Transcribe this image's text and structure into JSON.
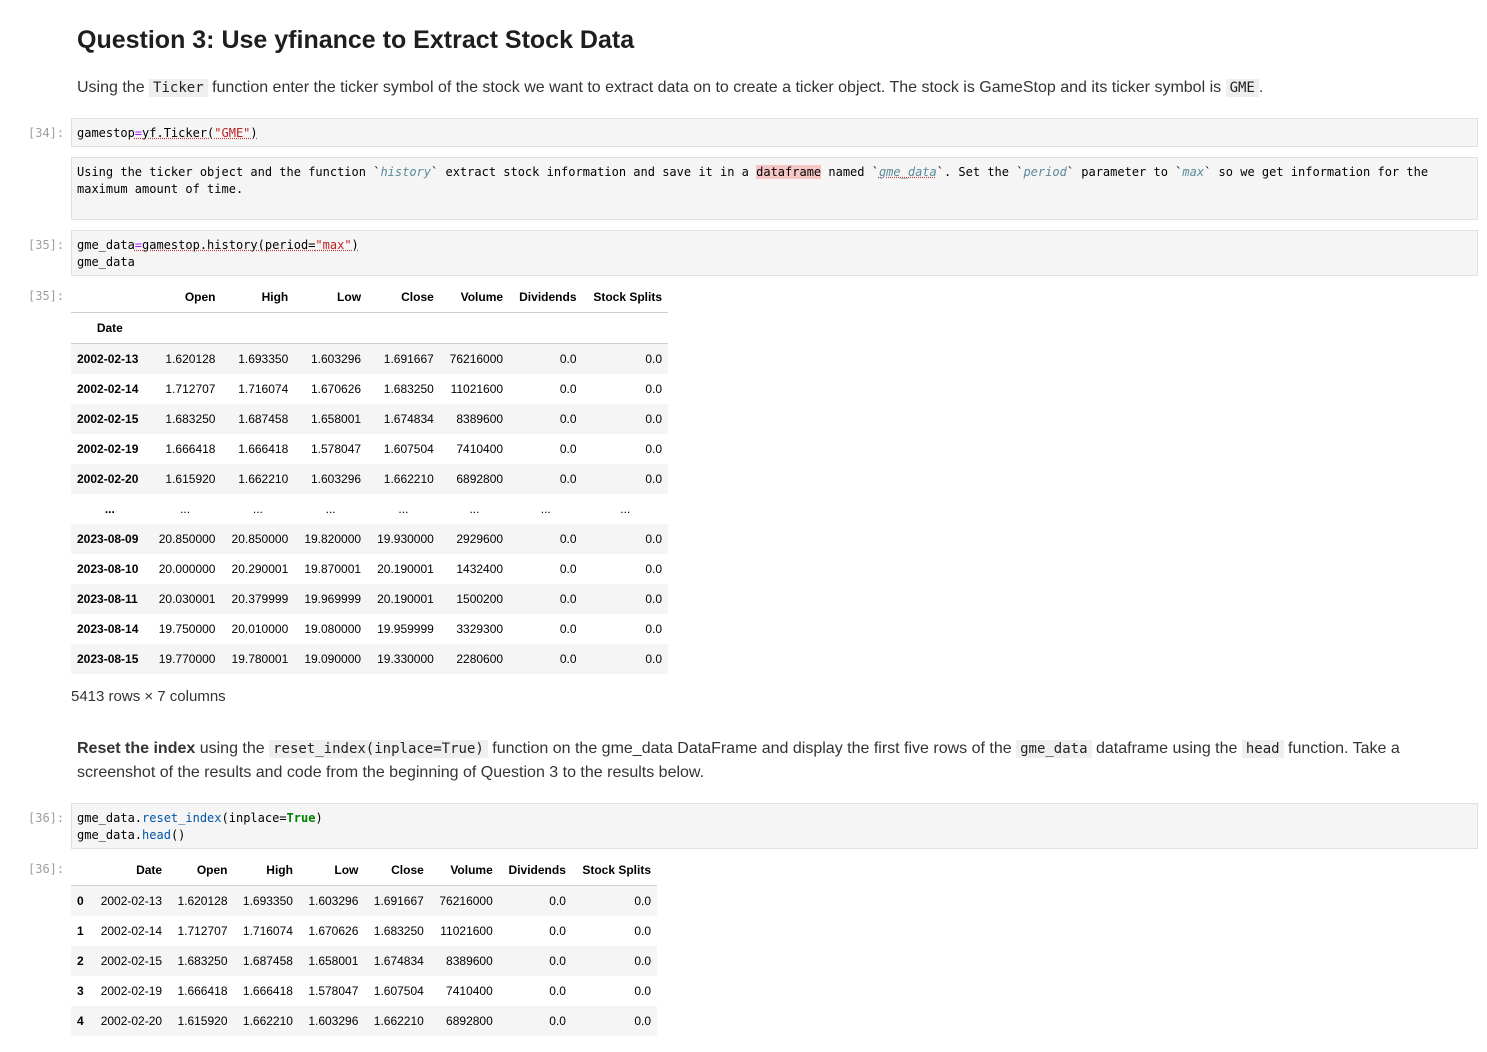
{
  "heading": "Question 3: Use yfinance to Extract Stock Data",
  "intro": {
    "p1": "Using the ",
    "code1": "Ticker",
    "p2": " function enter the ticker symbol of the stock we want to extract data on to create a ticker object. The stock is GameStop and its ticker symbol is ",
    "code2": "GME",
    "p3": "."
  },
  "prompts": {
    "c34": "[34]:",
    "c35": "[35]:",
    "o35": "[35]:",
    "c36": "[36]:",
    "o36": "[36]:"
  },
  "cell34": {
    "var": "gamestop",
    "eq": "=",
    "call": "yf.Ticker(",
    "arg": "\"GME\"",
    "close": ")"
  },
  "md_cell": {
    "t1": "Using the ticker object and the function `",
    "i1": "history",
    "t2": "` extract stock information and save it in a ",
    "hl": "dataframe",
    "t3": " named `",
    "i2": "gme_data",
    "t4": "`. Set the `",
    "i3": "period",
    "t5": "` parameter to `",
    "i4": "max",
    "t6": "` so we get information for the maximum amount of time."
  },
  "cell35": {
    "l1a": "gme_data",
    "l1b": "=",
    "l1c": "gamestop.history(period=",
    "l1d": "\"max\"",
    "l1e": ")",
    "l2": "gme_data"
  },
  "table1": {
    "columns": [
      "Open",
      "High",
      "Low",
      "Close",
      "Volume",
      "Dividends",
      "Stock Splits"
    ],
    "index_name": "Date",
    "rows": [
      [
        "2002-02-13",
        "1.620128",
        "1.693350",
        "1.603296",
        "1.691667",
        "76216000",
        "0.0",
        "0.0"
      ],
      [
        "2002-02-14",
        "1.712707",
        "1.716074",
        "1.670626",
        "1.683250",
        "11021600",
        "0.0",
        "0.0"
      ],
      [
        "2002-02-15",
        "1.683250",
        "1.687458",
        "1.658001",
        "1.674834",
        "8389600",
        "0.0",
        "0.0"
      ],
      [
        "2002-02-19",
        "1.666418",
        "1.666418",
        "1.578047",
        "1.607504",
        "7410400",
        "0.0",
        "0.0"
      ],
      [
        "2002-02-20",
        "1.615920",
        "1.662210",
        "1.603296",
        "1.662210",
        "6892800",
        "0.0",
        "0.0"
      ],
      [
        "...",
        "...",
        "...",
        "...",
        "...",
        "...",
        "...",
        "..."
      ],
      [
        "2023-08-09",
        "20.850000",
        "20.850000",
        "19.820000",
        "19.930000",
        "2929600",
        "0.0",
        "0.0"
      ],
      [
        "2023-08-10",
        "20.000000",
        "20.290001",
        "19.870001",
        "20.190001",
        "1432400",
        "0.0",
        "0.0"
      ],
      [
        "2023-08-11",
        "20.030001",
        "20.379999",
        "19.969999",
        "20.190001",
        "1500200",
        "0.0",
        "0.0"
      ],
      [
        "2023-08-14",
        "19.750000",
        "20.010000",
        "19.080000",
        "19.959999",
        "3329300",
        "0.0",
        "0.0"
      ],
      [
        "2023-08-15",
        "19.770000",
        "19.780001",
        "19.090000",
        "19.330000",
        "2280600",
        "0.0",
        "0.0"
      ]
    ],
    "shape_note": "5413 rows × 7 columns"
  },
  "reset_para": {
    "bold": "Reset the index",
    "p1": " using the ",
    "code1": "reset_index(inplace=True)",
    "p2": " function on the gme_data DataFrame and display the first five rows of the ",
    "code2": "gme_data",
    "p3": " dataframe using the ",
    "code3": "head",
    "p4": " function. Take a screenshot of the results and code from the beginning of Question 3 to the results below."
  },
  "cell36": {
    "l1a": "gme_data.",
    "l1b": "reset_index",
    "l1c": "(inplace=",
    "l1d": "True",
    "l1e": ")",
    "l2a": "gme_data.",
    "l2b": "head",
    "l2c": "()"
  },
  "table2": {
    "columns": [
      "Date",
      "Open",
      "High",
      "Low",
      "Close",
      "Volume",
      "Dividends",
      "Stock Splits"
    ],
    "rows": [
      [
        "0",
        "2002-02-13",
        "1.620128",
        "1.693350",
        "1.603296",
        "1.691667",
        "76216000",
        "0.0",
        "0.0"
      ],
      [
        "1",
        "2002-02-14",
        "1.712707",
        "1.716074",
        "1.670626",
        "1.683250",
        "11021600",
        "0.0",
        "0.0"
      ],
      [
        "2",
        "2002-02-15",
        "1.683250",
        "1.687458",
        "1.658001",
        "1.674834",
        "8389600",
        "0.0",
        "0.0"
      ],
      [
        "3",
        "2002-02-19",
        "1.666418",
        "1.666418",
        "1.578047",
        "1.607504",
        "7410400",
        "0.0",
        "0.0"
      ],
      [
        "4",
        "2002-02-20",
        "1.615920",
        "1.662210",
        "1.603296",
        "1.662210",
        "6892800",
        "0.0",
        "0.0"
      ]
    ]
  }
}
